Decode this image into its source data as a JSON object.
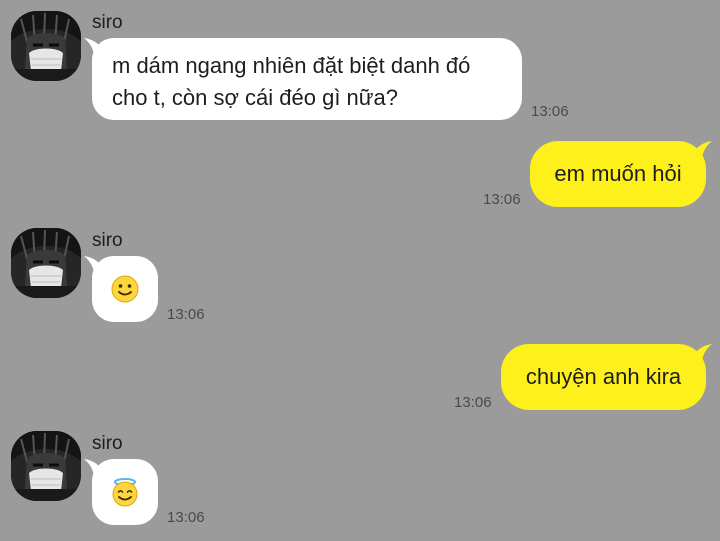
{
  "chat": {
    "messages": [
      {
        "sender": "siro",
        "text": "m dám ngang nhiên đặt biệt danh đó cho t, còn sợ cái đéo gì nữa?",
        "time": "13:06"
      },
      {
        "sender": "me",
        "text": "em muốn hỏi",
        "time": "13:06"
      },
      {
        "sender": "siro",
        "emoji": "slightly-smiling-face-emoji",
        "time": "13:06"
      },
      {
        "sender": "me",
        "text": "chuyện anh kira",
        "time": "13:06"
      },
      {
        "sender": "siro",
        "emoji": "smiling-face-with-halo-emoji",
        "time": "13:06"
      }
    ]
  },
  "colors": {
    "background": "#9b9b9b",
    "incoming_bubble": "#ffffff",
    "outgoing_bubble": "#fef01b"
  }
}
